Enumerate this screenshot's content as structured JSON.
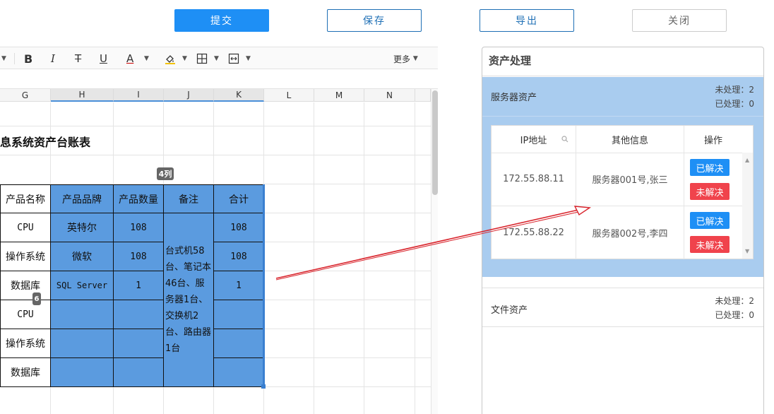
{
  "actions": {
    "submit": "提交",
    "save": "保存",
    "export": "导出",
    "close": "关闭"
  },
  "toolbar": {
    "bold": "B",
    "italic": "I",
    "strike": "T",
    "underline": "U",
    "font_color": "A",
    "more": "更多"
  },
  "sheet": {
    "columns": [
      "G",
      "H",
      "I",
      "J",
      "K",
      "L",
      "M",
      "N"
    ],
    "title": "息系统资产台账表",
    "selection_badge": "4列",
    "row_badge": "6",
    "headers": [
      "产品名称",
      "产品品牌",
      "产品数量",
      "备注",
      "合计"
    ],
    "rows": [
      {
        "name": "CPU",
        "brand": "英特尔",
        "qty": "108",
        "total": "108"
      },
      {
        "name": "操作系统",
        "brand": "微软",
        "qty": "108",
        "total": "108"
      },
      {
        "name": "数据库",
        "brand": "SQL Server",
        "qty": "1",
        "total": "1"
      },
      {
        "name": "CPU",
        "brand": "",
        "qty": "",
        "total": ""
      },
      {
        "name": "操作系统",
        "brand": "",
        "qty": "",
        "total": ""
      },
      {
        "name": "数据库",
        "brand": "",
        "qty": "",
        "total": ""
      }
    ],
    "note": "台式机58台、笔记本46台、服务器1台、交换机2台、路由器1台"
  },
  "panel": {
    "title": "资产处理",
    "sections": [
      {
        "name": "服务器资产",
        "unprocessed": "未处理：2",
        "processed": "已处理：0",
        "table": {
          "headers": [
            "IP地址",
            "其他信息",
            "操作"
          ],
          "rows": [
            {
              "ip": "172.55.88.11",
              "info": "服务器001号,张三",
              "solved": "已解决",
              "unsolved": "未解决"
            },
            {
              "ip": "172.55.88.22",
              "info": "服务器002号,李四",
              "solved": "已解决",
              "unsolved": "未解决"
            }
          ]
        }
      },
      {
        "name": "文件资产",
        "unprocessed": "未处理：2",
        "processed": "已处理：0"
      }
    ]
  },
  "colors": {
    "primary": "#1e8ff5",
    "selection": "#5b9bdf",
    "section_bg": "#a9ccef",
    "danger": "#f0434c",
    "arrow": "#d9262e"
  }
}
